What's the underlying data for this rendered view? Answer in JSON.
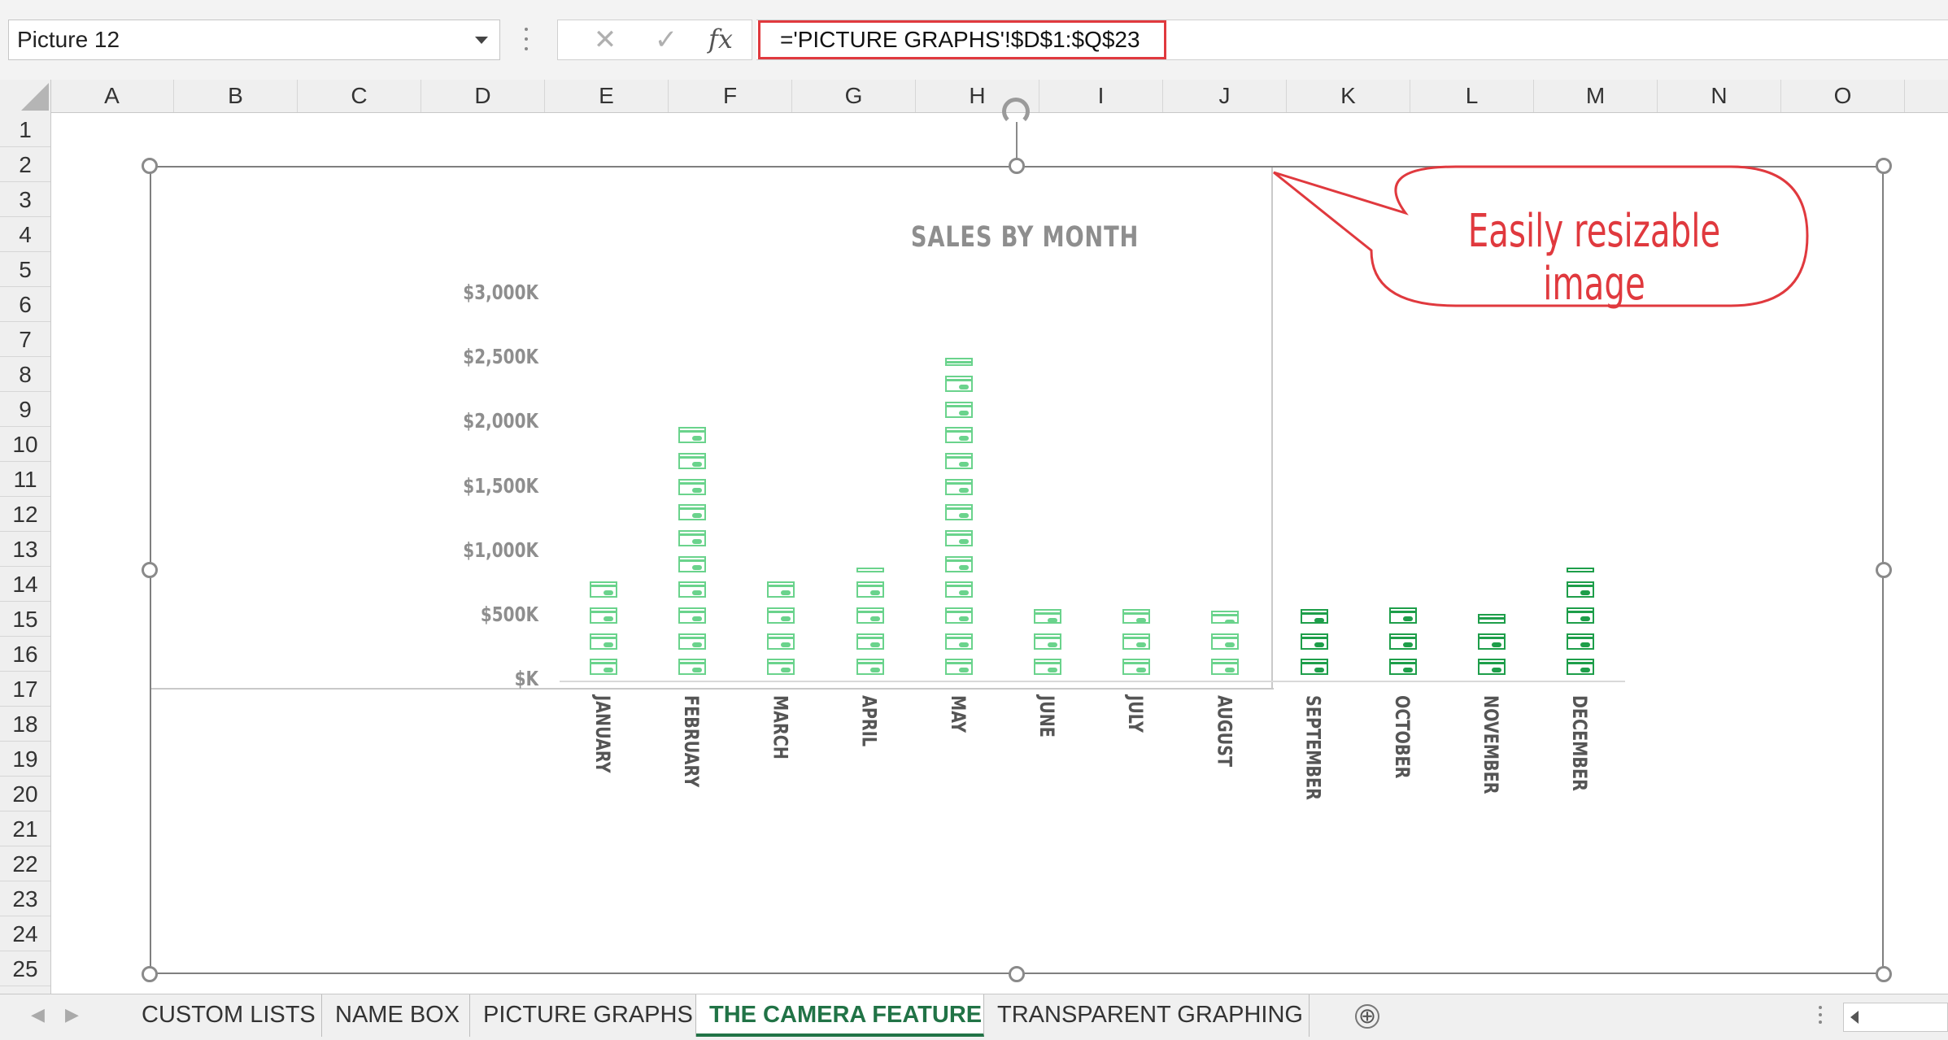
{
  "name_box": {
    "value": "Picture 12"
  },
  "formula_bar": {
    "cancel_icon": "✕",
    "enter_icon": "✓",
    "fx_label": "fx",
    "formula": "='PICTURE GRAPHS'!$D$1:$Q$23"
  },
  "columns": [
    "A",
    "B",
    "C",
    "D",
    "E",
    "F",
    "G",
    "H",
    "I",
    "J",
    "K",
    "L",
    "M",
    "N",
    "O"
  ],
  "rows": [
    "1",
    "2",
    "3",
    "4",
    "5",
    "6",
    "7",
    "8",
    "9",
    "10",
    "11",
    "12",
    "13",
    "14",
    "15",
    "16",
    "17",
    "18",
    "19",
    "20",
    "21",
    "22",
    "23",
    "24",
    "25"
  ],
  "chart_data": {
    "type": "bar",
    "title": "SALES BY MONTH",
    "categories": [
      "JANUARY",
      "FEBRUARY",
      "MARCH",
      "APRIL",
      "MAY",
      "JUNE",
      "JULY",
      "AUGUST",
      "SEPTEMBER",
      "OCTOBER",
      "NOVEMBER",
      "DECEMBER"
    ],
    "values": [
      800,
      2000,
      800,
      825,
      2500,
      575,
      575,
      550,
      575,
      600,
      525,
      825
    ],
    "ytick_labels": [
      "$K",
      "$500K",
      "$1,000K",
      "$1,500K",
      "$2,000K",
      "$2,500K",
      "$3,000K"
    ],
    "ylim": [
      0,
      3000
    ],
    "unit_per_icon": 200,
    "series_colors": {
      "light": "#6ad38c",
      "dark": "#1e9e4a"
    },
    "legend": "none",
    "grid": false
  },
  "callout": {
    "text": "Easily resizable image",
    "color": "#e0393e"
  },
  "sheet_tabs": {
    "tabs": [
      "CUSTOM LISTS",
      "NAME BOX",
      "PICTURE GRAPHS",
      "THE CAMERA FEATURE",
      "TRANSPARENT GRAPHING"
    ],
    "active": "THE CAMERA FEATURE",
    "add_icon": "⊕"
  },
  "accent_color": "#217346"
}
